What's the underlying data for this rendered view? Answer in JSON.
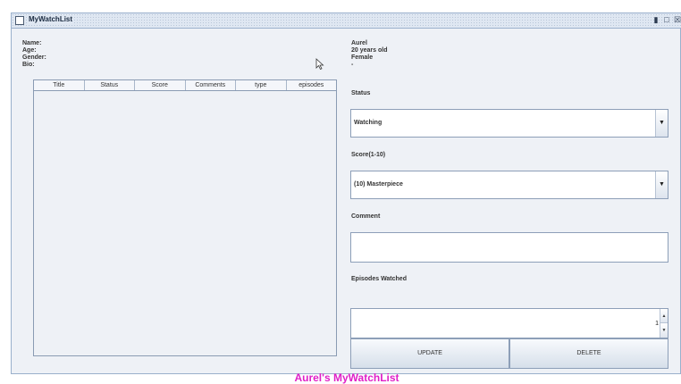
{
  "window": {
    "title": "MyWatchList"
  },
  "profile": {
    "labels": [
      "Name:",
      "Age:",
      "Gender:",
      "Bio:"
    ],
    "values": [
      "Aurel",
      "20 years old",
      "Female",
      "-"
    ]
  },
  "table": {
    "columns": [
      "Title",
      "Status",
      "Score",
      "Comments",
      "type",
      "episodes"
    ]
  },
  "form": {
    "status_label": "Status",
    "status_value": "Watching",
    "score_label": "Score(1-10)",
    "score_value": "(10) Masterpiece",
    "comment_label": "Comment",
    "comment_value": "",
    "episodes_label": "Episodes Watched",
    "episodes_value": "1"
  },
  "buttons": {
    "update": "UPDATE",
    "delete": "DELETE"
  },
  "footer": {
    "text": "Aurel's MyWatchList"
  },
  "colors": {
    "footer": "#e020c8",
    "frame_border": "#9ab0cc"
  }
}
